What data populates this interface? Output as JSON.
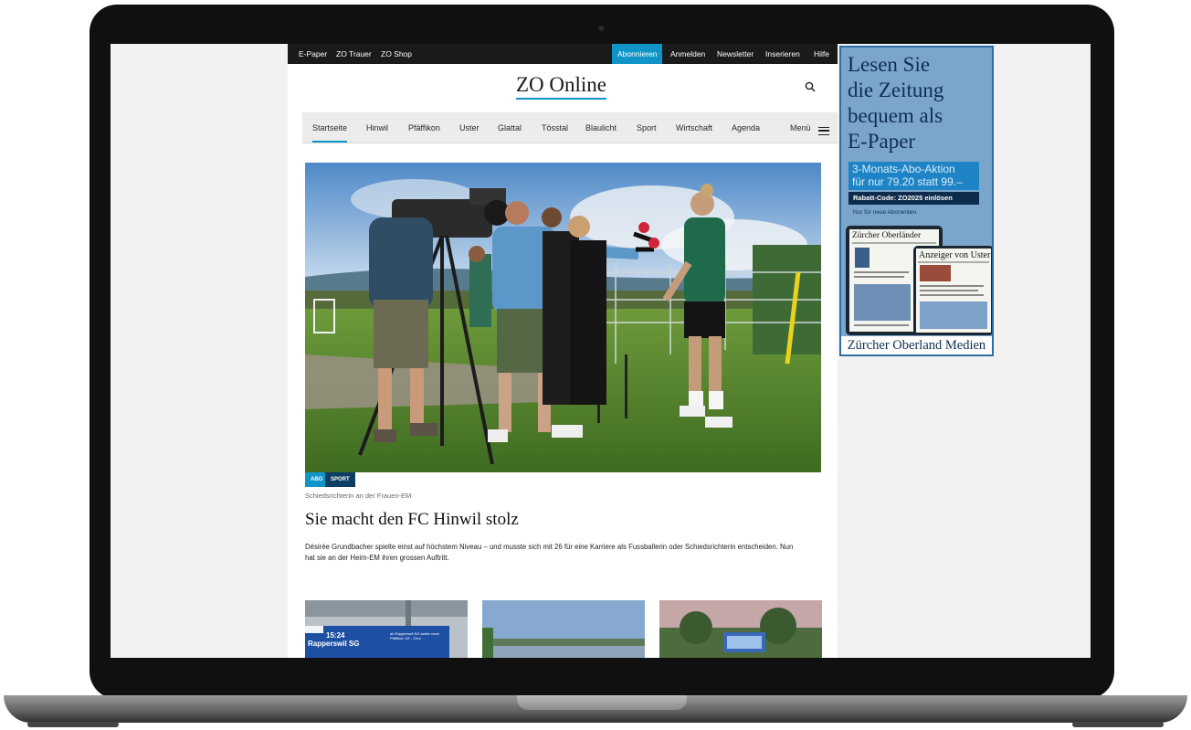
{
  "topbar": {
    "left_links": [
      "E-Paper",
      "ZO Trauer",
      "ZO Shop"
    ],
    "subscribe": "Abonnieren",
    "right_links": [
      "Anmelden",
      "Newsletter",
      "Inserieren",
      "Hilfe"
    ]
  },
  "logo": "ZO Online",
  "nav": {
    "items": [
      "Startseite",
      "Hinwil",
      "Pfäffikon",
      "Uster",
      "Glattal",
      "Tösstal",
      "Blaulicht",
      "Sport",
      "Wirtschaft",
      "Agenda"
    ],
    "menu": "Menü"
  },
  "article": {
    "tags": [
      "ABO",
      "SPORT"
    ],
    "kicker": "Schiedsrichterin an der Frauen-EM",
    "headline": "Sie macht den FC Hinwil stolz",
    "lead": "Désirée Grundbacher spielte einst auf höchstem Niveau – und musste sich mit 26 für eine Karriere als Fussballerin oder Schiedsrichterin entscheiden. Nun hat sie an der Heim-EM ihren grossen Auftritt."
  },
  "thumbs": {
    "board_time": "15:24",
    "board_destination": "Rapperswil SG",
    "board_info": "ab Rapperswil SG weiter nach Pfäffikon SZ - Chur"
  },
  "ad": {
    "headline": [
      "Lesen Sie",
      "die Zeitung",
      "bequem als",
      "E-Paper"
    ],
    "offer": [
      "3-Monats-Abo-Aktion",
      "für nur 79.20 statt 99.–"
    ],
    "code": "Rabatt-Code: ZO2025 einlösen",
    "note": "Nur für neue Abonenten.",
    "paper1": "Zürcher Oberländer",
    "paper2": "Anzeiger von Uster",
    "brand": "Zürcher Oberland Medien"
  },
  "colors": {
    "accent": "#1095c9",
    "dark_blue": "#0e3d63",
    "ad_bg": "#7aa6cc"
  }
}
